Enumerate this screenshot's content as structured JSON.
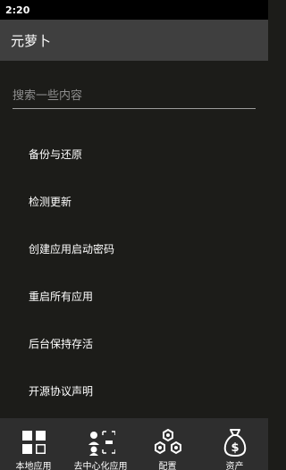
{
  "status_bar": {
    "time": "2:20"
  },
  "app_bar": {
    "title": "元萝卜"
  },
  "search": {
    "placeholder": "搜索一些内容"
  },
  "menu": {
    "items": [
      {
        "label": "备份与还原"
      },
      {
        "label": "检测更新"
      },
      {
        "label": "创建应用启动密码"
      },
      {
        "label": "重启所有应用"
      },
      {
        "label": "后台保持存活"
      },
      {
        "label": "开源协议声明"
      }
    ]
  },
  "bottom_nav": {
    "items": [
      {
        "label": "本地应用",
        "icon": "grid-icon"
      },
      {
        "label": "去中心化应用",
        "icon": "people-network-icon"
      },
      {
        "label": "配置",
        "icon": "hexagon-nuts-icon"
      },
      {
        "label": "资产",
        "icon": "money-bag-icon"
      }
    ]
  },
  "colors": {
    "status_bar": "#000000",
    "app_bar": "#3f3f3f",
    "background": "#1c1c19",
    "bottom_nav": "#2e2e2e",
    "search_underline": "#9c9c9c",
    "text": "#ffffff"
  }
}
